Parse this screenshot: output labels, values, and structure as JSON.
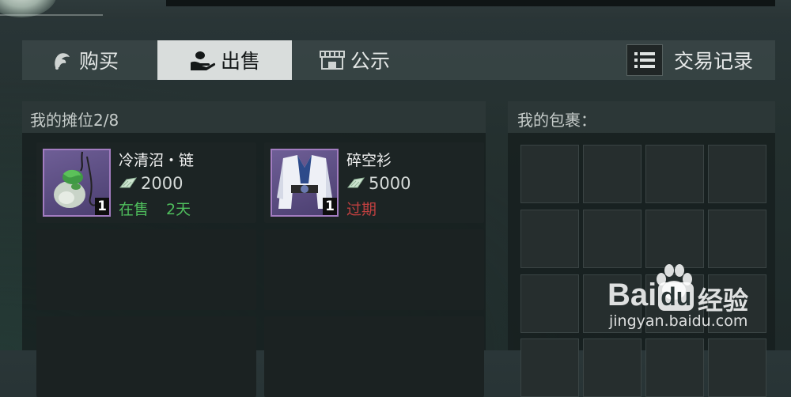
{
  "tabs": [
    {
      "label": "购买",
      "icon": "hand-icon",
      "active": false
    },
    {
      "label": "出售",
      "icon": "coin-hand-icon",
      "active": true
    },
    {
      "label": "公示",
      "icon": "shop-icon",
      "active": false
    }
  ],
  "records": {
    "label": "交易记录",
    "icon": "list-icon"
  },
  "stall": {
    "title": "我的摊位2/8",
    "items": [
      {
        "name": "冷清沼・链",
        "price": "2000",
        "qty": "1",
        "status": "在售",
        "remaining": "2天",
        "icon": "jade-pendant-icon"
      },
      {
        "name": "碎空衫",
        "price": "5000",
        "qty": "1",
        "status": "过期",
        "remaining": "",
        "icon": "robe-icon"
      }
    ]
  },
  "bag": {
    "title": "我的包裹："
  },
  "watermark": {
    "logo": "Bai",
    "logo_suffix": "du",
    "brand": "经验",
    "url": "jingyan.baidu.com"
  },
  "colors": {
    "on_sale": "#4fbf5d",
    "expired": "#c14040",
    "rarity_purple": "#a27cc0"
  }
}
